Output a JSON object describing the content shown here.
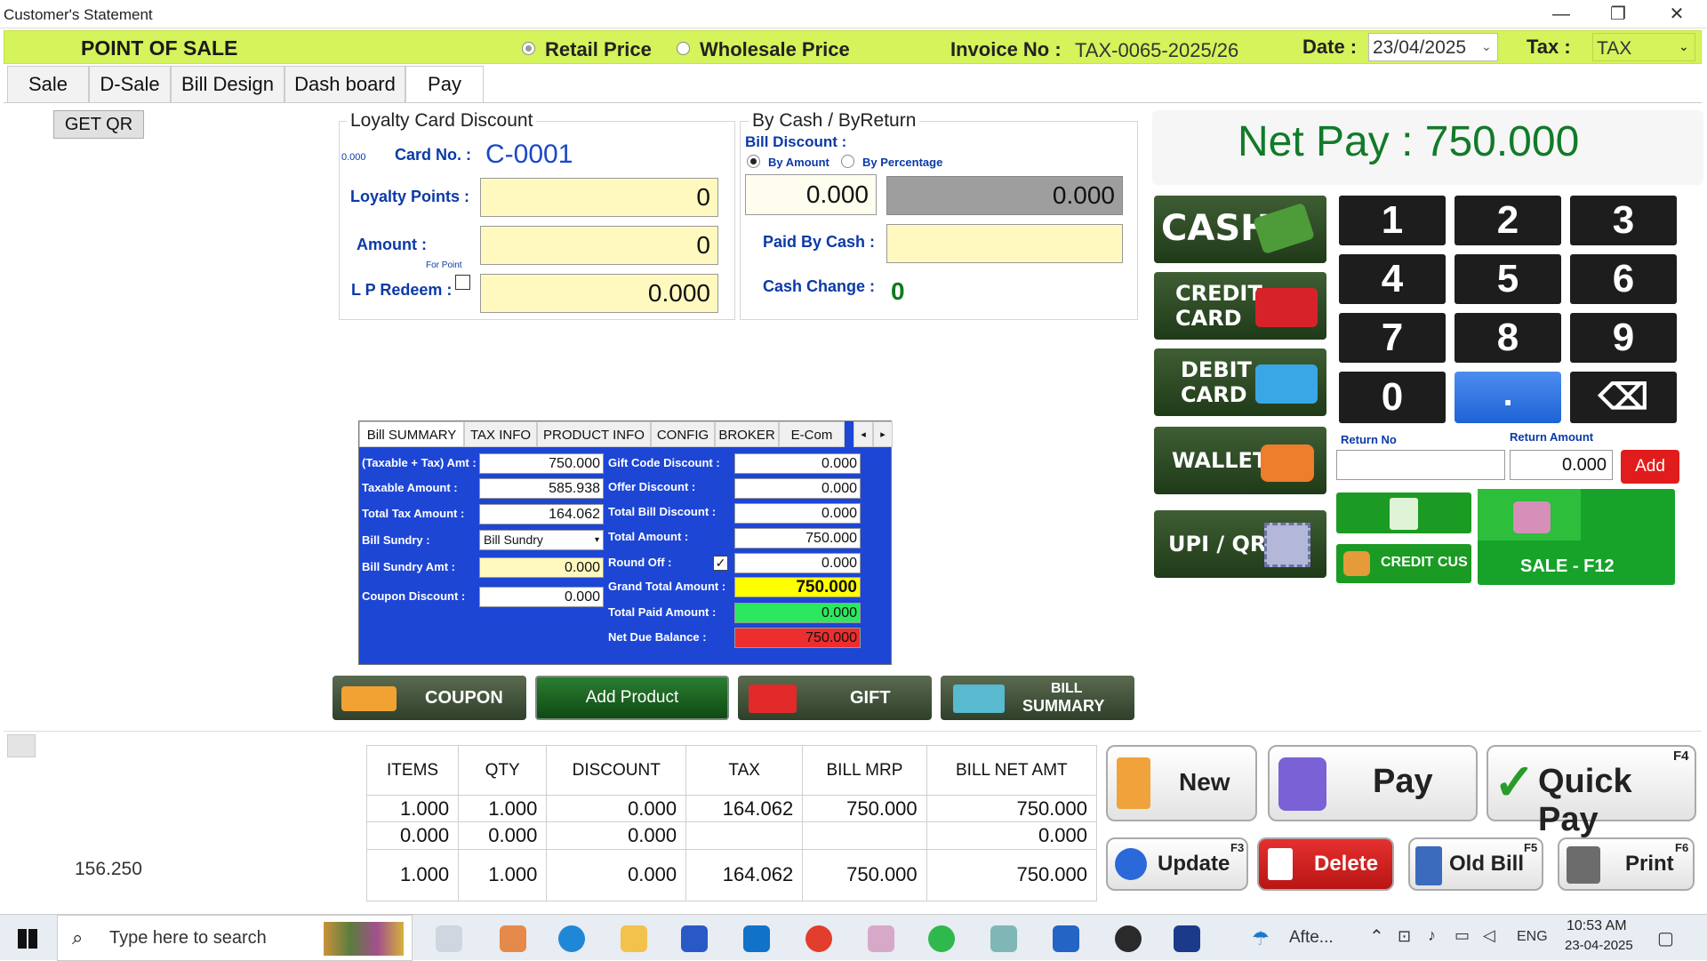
{
  "window": {
    "title": "Customer's Statement",
    "minimize": "—",
    "restore": "❐",
    "close": "✕"
  },
  "topbar": {
    "title": "POINT OF SALE",
    "retail_label": "Retail Price",
    "wholesale_label": "Wholesale Price",
    "invoice_label": "Invoice No :",
    "invoice_value": "TAX-0065-2025/26",
    "date_label": "Date :",
    "date_value": "23/04/2025",
    "tax_label": "Tax :",
    "tax_value": "TAX"
  },
  "tabs": [
    "Sale",
    "D-Sale",
    "Bill Design",
    "Dash board",
    "Pay"
  ],
  "active_tab": "Pay",
  "get_qr": "GET QR",
  "loyalty": {
    "title": "Loyalty Card Discount",
    "small_value": "0.000",
    "card_label": "Card No. :",
    "card_value": "C-0001",
    "points_label": "Loyalty Points :",
    "points_value": "0",
    "amount_label": "Amount :",
    "amount_value": "0",
    "for_point": "For Point",
    "redeem_label": "L P Redeem :",
    "redeem_value": "0.000"
  },
  "bycash": {
    "title": "By Cash / ByReturn",
    "bill_discount_label": "Bill Discount :",
    "by_amount": "By Amount",
    "by_percentage": "By Percentage",
    "discount_value": "0.000",
    "discount_total": "0.000",
    "paid_by_cash_label": "Paid By Cash :",
    "paid_by_cash_value": "",
    "cash_change_label": "Cash Change :",
    "cash_change_value": "0"
  },
  "net_pay": "Net Pay : 750.000",
  "payment_methods": {
    "cash": "CASH",
    "credit_card": [
      "CREDIT",
      "CARD"
    ],
    "debit_card": [
      "DEBIT",
      "CARD"
    ],
    "wallet": "WALLET",
    "upi": "UPI / QR"
  },
  "keypad": [
    "1",
    "2",
    "3",
    "4",
    "5",
    "6",
    "7",
    "8",
    "9",
    "0",
    ".",
    "⌫"
  ],
  "return": {
    "no_label": "Return No",
    "no_value": "",
    "amount_label": "Return Amount",
    "amount_value": "0.000",
    "add": "Add"
  },
  "credit_cus": "CREDIT CUS",
  "sale_f12": "SALE - F12",
  "summary_tabs": [
    "Bill SUMMARY",
    "TAX INFO",
    "PRODUCT INFO",
    "CONFIG",
    "BROKER",
    "E-Com"
  ],
  "summary_left": [
    {
      "label": "(Taxable + Tax) Amt :",
      "value": "750.000"
    },
    {
      "label": "Taxable Amount :",
      "value": "585.938"
    },
    {
      "label": "Total Tax Amount :",
      "value": "164.062"
    },
    {
      "label": "Bill Sundry :",
      "value": "Bill Sundry"
    },
    {
      "label": "Bill Sundry Amt :",
      "value": "0.000"
    },
    {
      "label": "Coupon Discount :",
      "value": "0.000"
    }
  ],
  "summary_right": [
    {
      "label": "Gift Code Discount :",
      "value": "0.000"
    },
    {
      "label": "Offer Discount :",
      "value": "0.000"
    },
    {
      "label": "Total Bill Discount :",
      "value": "0.000"
    },
    {
      "label": "Total Amount :",
      "value": "750.000"
    },
    {
      "label": "Round Off :",
      "value": "0.000"
    },
    {
      "label": "Grand Total Amount :",
      "value": "750.000"
    },
    {
      "label": "Total Paid Amount :",
      "value": "0.000"
    },
    {
      "label": "Net Due Balance :",
      "value": "750.000"
    }
  ],
  "action_strip": {
    "coupon": "COUPON",
    "add_product": "Add Product",
    "gift": "GIFT",
    "bill_summary": [
      "BILL",
      "SUMMARY"
    ]
  },
  "left_value": "156.250",
  "table": {
    "headers": [
      "ITEMS",
      "QTY",
      "DISCOUNT",
      "TAX",
      "BILL MRP",
      "BILL NET AMT"
    ],
    "rows": [
      [
        "1.000",
        "1.000",
        "0.000",
        "164.062",
        "750.000",
        "750.000"
      ],
      [
        "0.000",
        "0.000",
        "0.000",
        "",
        "",
        "0.000"
      ],
      [
        "1.000",
        "1.000",
        "0.000",
        "164.062",
        "750.000",
        "750.000"
      ]
    ]
  },
  "actions": {
    "new": "New",
    "pay": "Pay",
    "quick_pay": "Quick Pay",
    "quick_pay_key": "F4",
    "update": "Update",
    "update_key": "F3",
    "delete": "Delete",
    "old_bill": "Old Bill",
    "old_bill_key": "F5",
    "print": "Print",
    "print_key": "F6"
  },
  "taskbar": {
    "search": "Type here to search",
    "weather": "Afte...",
    "lang": "ENG",
    "time": "10:53 AM",
    "date": "23-04-2025"
  }
}
